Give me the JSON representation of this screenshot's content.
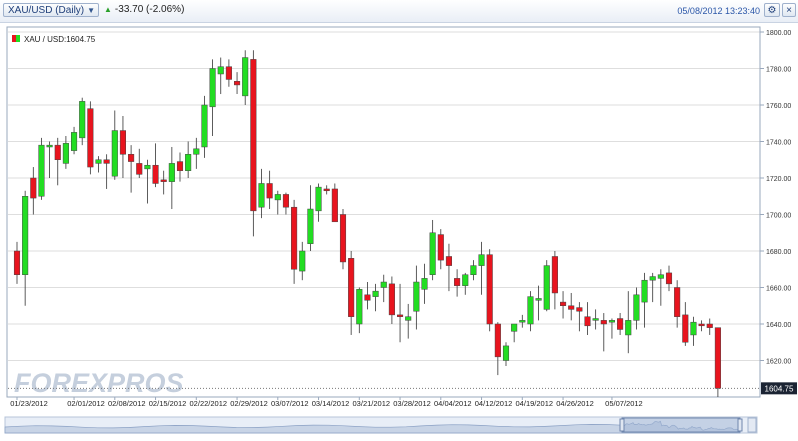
{
  "header": {
    "symbol_button": "XAU/USD (Daily)",
    "change": "-33.70 (-2.06%)",
    "datetime": "05/08/2012 13:23:40",
    "settings_icon": "gear-icon",
    "close_icon": "close-icon"
  },
  "legend": {
    "label": "XAU / USD:1604.75"
  },
  "last_price_label": "1604.75",
  "watermark": "FOREXPROS",
  "colors": {
    "up": "#22dd22",
    "down": "#e8141e",
    "grid": "#dedede",
    "border": "#9aa8bc",
    "accent": "#2a56a8"
  },
  "chart_data": {
    "type": "candlestick",
    "title": "XAU/USD (Daily)",
    "ylim": [
      1600,
      1800
    ],
    "y_ticks": [
      "1620.00",
      "1640.00",
      "1660.00",
      "1680.00",
      "1700.00",
      "1720.00",
      "1740.00",
      "1760.00",
      "1780.00",
      "1800.00"
    ],
    "x_ticks": [
      "01/23/2012",
      "02/01/2012",
      "02/08/2012",
      "02/15/2012",
      "02/22/2012",
      "02/29/2012",
      "03/07/2012",
      "03/14/2012",
      "03/21/2012",
      "03/28/2012",
      "04/04/2012",
      "04/12/2012",
      "04/19/2012",
      "04/26/2012",
      "05/07/2012"
    ],
    "x_tick_index": [
      0,
      7,
      12,
      17,
      22,
      27,
      32,
      37,
      42,
      47,
      52,
      57,
      62,
      67,
      73
    ],
    "last_price": 1604.75,
    "candles": [
      {
        "o": 1680,
        "h": 1685,
        "l": 1662,
        "c": 1667
      },
      {
        "o": 1667,
        "h": 1713,
        "l": 1650,
        "c": 1710
      },
      {
        "o": 1720,
        "h": 1726,
        "l": 1700,
        "c": 1709
      },
      {
        "o": 1710,
        "h": 1742,
        "l": 1708,
        "c": 1738
      },
      {
        "o": 1737,
        "h": 1740,
        "l": 1720,
        "c": 1738
      },
      {
        "o": 1738,
        "h": 1742,
        "l": 1716,
        "c": 1730
      },
      {
        "o": 1728,
        "h": 1743,
        "l": 1725,
        "c": 1739
      },
      {
        "o": 1735,
        "h": 1748,
        "l": 1733,
        "c": 1745
      },
      {
        "o": 1742,
        "h": 1764,
        "l": 1738,
        "c": 1762
      },
      {
        "o": 1758,
        "h": 1762,
        "l": 1722,
        "c": 1726
      },
      {
        "o": 1728,
        "h": 1732,
        "l": 1723,
        "c": 1730
      },
      {
        "o": 1730,
        "h": 1733,
        "l": 1714,
        "c": 1728
      },
      {
        "o": 1721,
        "h": 1757,
        "l": 1719,
        "c": 1746
      },
      {
        "o": 1746,
        "h": 1754,
        "l": 1720,
        "c": 1733
      },
      {
        "o": 1733,
        "h": 1738,
        "l": 1712,
        "c": 1729
      },
      {
        "o": 1728,
        "h": 1736,
        "l": 1720,
        "c": 1722
      },
      {
        "o": 1725,
        "h": 1730,
        "l": 1706,
        "c": 1727
      },
      {
        "o": 1727,
        "h": 1739,
        "l": 1715,
        "c": 1717
      },
      {
        "o": 1719,
        "h": 1724,
        "l": 1711,
        "c": 1718
      },
      {
        "o": 1718,
        "h": 1737,
        "l": 1703,
        "c": 1728
      },
      {
        "o": 1729,
        "h": 1734,
        "l": 1718,
        "c": 1724
      },
      {
        "o": 1724,
        "h": 1740,
        "l": 1720,
        "c": 1733
      },
      {
        "o": 1733,
        "h": 1742,
        "l": 1725,
        "c": 1736
      },
      {
        "o": 1737,
        "h": 1765,
        "l": 1731,
        "c": 1760
      },
      {
        "o": 1759,
        "h": 1785,
        "l": 1743,
        "c": 1780
      },
      {
        "o": 1777,
        "h": 1786,
        "l": 1766,
        "c": 1781
      },
      {
        "o": 1781,
        "h": 1785,
        "l": 1770,
        "c": 1774
      },
      {
        "o": 1773,
        "h": 1778,
        "l": 1766,
        "c": 1771
      },
      {
        "o": 1765,
        "h": 1790,
        "l": 1760,
        "c": 1786
      },
      {
        "o": 1785,
        "h": 1790,
        "l": 1688,
        "c": 1702
      },
      {
        "o": 1704,
        "h": 1725,
        "l": 1698,
        "c": 1717
      },
      {
        "o": 1717,
        "h": 1724,
        "l": 1703,
        "c": 1709
      },
      {
        "o": 1708,
        "h": 1713,
        "l": 1700,
        "c": 1711
      },
      {
        "o": 1711,
        "h": 1712,
        "l": 1700,
        "c": 1704
      },
      {
        "o": 1704,
        "h": 1708,
        "l": 1662,
        "c": 1670
      },
      {
        "o": 1669,
        "h": 1685,
        "l": 1664,
        "c": 1680
      },
      {
        "o": 1684,
        "h": 1716,
        "l": 1680,
        "c": 1703
      },
      {
        "o": 1702,
        "h": 1717,
        "l": 1696,
        "c": 1715
      },
      {
        "o": 1714,
        "h": 1716,
        "l": 1711,
        "c": 1713
      },
      {
        "o": 1714,
        "h": 1717,
        "l": 1700,
        "c": 1696
      },
      {
        "o": 1700,
        "h": 1703,
        "l": 1670,
        "c": 1674
      },
      {
        "o": 1676,
        "h": 1680,
        "l": 1634,
        "c": 1644
      },
      {
        "o": 1640,
        "h": 1660,
        "l": 1635,
        "c": 1659
      },
      {
        "o": 1656,
        "h": 1663,
        "l": 1648,
        "c": 1653
      },
      {
        "o": 1655,
        "h": 1662,
        "l": 1647,
        "c": 1658
      },
      {
        "o": 1660,
        "h": 1667,
        "l": 1652,
        "c": 1663
      },
      {
        "o": 1662,
        "h": 1666,
        "l": 1640,
        "c": 1645
      },
      {
        "o": 1645,
        "h": 1662,
        "l": 1630,
        "c": 1644
      },
      {
        "o": 1642,
        "h": 1651,
        "l": 1632,
        "c": 1644
      },
      {
        "o": 1647,
        "h": 1672,
        "l": 1637,
        "c": 1663
      },
      {
        "o": 1659,
        "h": 1673,
        "l": 1651,
        "c": 1665
      },
      {
        "o": 1667,
        "h": 1697,
        "l": 1664,
        "c": 1690
      },
      {
        "o": 1689,
        "h": 1692,
        "l": 1670,
        "c": 1675
      },
      {
        "o": 1677,
        "h": 1684,
        "l": 1658,
        "c": 1672
      },
      {
        "o": 1665,
        "h": 1670,
        "l": 1655,
        "c": 1661
      },
      {
        "o": 1661,
        "h": 1668,
        "l": 1656,
        "c": 1667
      },
      {
        "o": 1667,
        "h": 1675,
        "l": 1664,
        "c": 1672
      },
      {
        "o": 1672,
        "h": 1685,
        "l": 1656,
        "c": 1678
      },
      {
        "o": 1678,
        "h": 1681,
        "l": 1636,
        "c": 1640
      },
      {
        "o": 1640,
        "h": 1641,
        "l": 1612,
        "c": 1622
      },
      {
        "o": 1620,
        "h": 1630,
        "l": 1617,
        "c": 1628
      },
      {
        "o": 1636,
        "h": 1640,
        "l": 1630,
        "c": 1640
      },
      {
        "o": 1641,
        "h": 1645,
        "l": 1638,
        "c": 1642
      },
      {
        "o": 1640,
        "h": 1658,
        "l": 1636,
        "c": 1655
      },
      {
        "o": 1653,
        "h": 1661,
        "l": 1642,
        "c": 1654
      },
      {
        "o": 1648,
        "h": 1675,
        "l": 1647,
        "c": 1672
      },
      {
        "o": 1677,
        "h": 1680,
        "l": 1648,
        "c": 1657
      },
      {
        "o": 1652,
        "h": 1658,
        "l": 1643,
        "c": 1650
      },
      {
        "o": 1650,
        "h": 1657,
        "l": 1642,
        "c": 1648
      },
      {
        "o": 1649,
        "h": 1652,
        "l": 1636,
        "c": 1647
      },
      {
        "o": 1644,
        "h": 1652,
        "l": 1634,
        "c": 1639
      },
      {
        "o": 1642,
        "h": 1648,
        "l": 1637,
        "c": 1643
      },
      {
        "o": 1642,
        "h": 1646,
        "l": 1625,
        "c": 1640
      },
      {
        "o": 1641,
        "h": 1643,
        "l": 1632,
        "c": 1642
      },
      {
        "o": 1643,
        "h": 1646,
        "l": 1634,
        "c": 1637
      },
      {
        "o": 1634,
        "h": 1658,
        "l": 1624,
        "c": 1642
      },
      {
        "o": 1642,
        "h": 1660,
        "l": 1637,
        "c": 1656
      },
      {
        "o": 1652,
        "h": 1668,
        "l": 1638,
        "c": 1664
      },
      {
        "o": 1664,
        "h": 1668,
        "l": 1652,
        "c": 1666
      },
      {
        "o": 1665,
        "h": 1670,
        "l": 1650,
        "c": 1667
      },
      {
        "o": 1668,
        "h": 1672,
        "l": 1658,
        "c": 1662
      },
      {
        "o": 1660,
        "h": 1664,
        "l": 1638,
        "c": 1644
      },
      {
        "o": 1645,
        "h": 1652,
        "l": 1628,
        "c": 1630
      },
      {
        "o": 1634,
        "h": 1644,
        "l": 1628,
        "c": 1641
      },
      {
        "o": 1640,
        "h": 1642,
        "l": 1636,
        "c": 1639
      },
      {
        "o": 1640,
        "h": 1643,
        "l": 1634,
        "c": 1638
      },
      {
        "o": 1638,
        "h": 1638,
        "l": 1600,
        "c": 1604.75
      }
    ]
  }
}
